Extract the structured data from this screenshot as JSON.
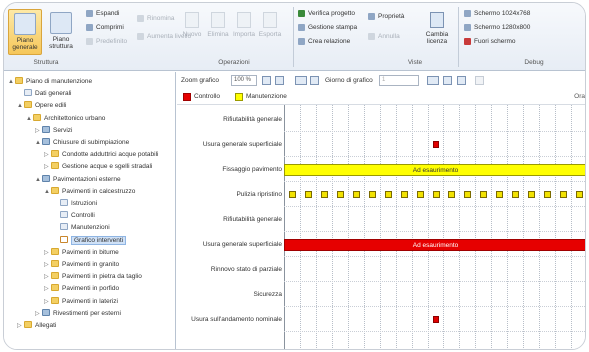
{
  "ribbon": {
    "large_buttons": [
      {
        "label": "Piano generale",
        "icon": "plan-icon",
        "active": true
      },
      {
        "label": "Piano struttura",
        "icon": "structure-icon",
        "active": false
      }
    ],
    "col1": [
      "Espandi",
      "Comprimi",
      "Predefinito"
    ],
    "col2": [
      "Rinomina",
      "Aumenta livello"
    ],
    "mid_buttons": [
      "Nuovo",
      "Elimina",
      "Importa",
      "Esporta"
    ],
    "col4": [
      "Verifica progetto",
      "Gestione stampa",
      "Crea relazione"
    ],
    "col5": [
      "Proprietà",
      "Annulla"
    ],
    "cambia": "Cambia licenza",
    "right_col": [
      "Schermo 1024x768",
      "Schermo 1280x800",
      "Fuori schermo"
    ],
    "groups": [
      "Struttura",
      "Operazioni",
      "Viste",
      "Debug"
    ]
  },
  "tree": {
    "items": [
      {
        "label": "Piano di manutenzione",
        "depth": 0,
        "toggle": "▲",
        "icon": "folder"
      },
      {
        "label": "Dati generali",
        "depth": 1,
        "toggle": "",
        "icon": "doc"
      },
      {
        "label": "Opere edili",
        "depth": 1,
        "toggle": "▲",
        "icon": "folder"
      },
      {
        "label": "Architettonico urbano",
        "depth": 2,
        "toggle": "▲",
        "icon": "folder"
      },
      {
        "label": "Servizi",
        "depth": 3,
        "toggle": "▷",
        "icon": "net"
      },
      {
        "label": "Chiusure di subimpiazione",
        "depth": 3,
        "toggle": "▲",
        "icon": "net"
      },
      {
        "label": "Condotte adduttrici acque potabili",
        "depth": 4,
        "toggle": "▷",
        "icon": "folder"
      },
      {
        "label": "Gestione acque e sgelli stradali",
        "depth": 4,
        "toggle": "▷",
        "icon": "folder"
      },
      {
        "label": "Pavimentazioni esterne",
        "depth": 3,
        "toggle": "▲",
        "icon": "net"
      },
      {
        "label": "Pavimenti in calcestruzzo",
        "depth": 4,
        "toggle": "▲",
        "icon": "folder"
      },
      {
        "label": "Istruzioni",
        "depth": 5,
        "toggle": "",
        "icon": "doc"
      },
      {
        "label": "Controlli",
        "depth": 5,
        "toggle": "",
        "icon": "doc"
      },
      {
        "label": "Manutenzioni",
        "depth": 5,
        "toggle": "",
        "icon": "doc"
      },
      {
        "label": "Grafico interventi",
        "depth": 5,
        "toggle": "",
        "icon": "chart",
        "selected": true
      },
      {
        "label": "Pavimenti in bitume",
        "depth": 4,
        "toggle": "▷",
        "icon": "folder"
      },
      {
        "label": "Pavimenti in granito",
        "depth": 4,
        "toggle": "▷",
        "icon": "folder"
      },
      {
        "label": "Pavimenti in pietra da taglio",
        "depth": 4,
        "toggle": "▷",
        "icon": "folder"
      },
      {
        "label": "Pavimenti in porfido",
        "depth": 4,
        "toggle": "▷",
        "icon": "folder"
      },
      {
        "label": "Pavimenti in laterizi",
        "depth": 4,
        "toggle": "▷",
        "icon": "folder"
      },
      {
        "label": "Rivestimenti per esterni",
        "depth": 3,
        "toggle": "▷",
        "icon": "net"
      },
      {
        "label": "Allegati",
        "depth": 1,
        "toggle": "▷",
        "icon": "folder"
      }
    ]
  },
  "toolbar": {
    "zoom_label": "Zoom grafico",
    "zoom_value": "100 %",
    "start_label": "Giorno di grafico",
    "start_value": "1"
  },
  "legend": {
    "items": [
      {
        "label": "Controllo",
        "color": "#e60000"
      },
      {
        "label": "Manutenzione",
        "color": "#ffff00"
      }
    ],
    "right_text": "Ora"
  },
  "gantt": {
    "rows": [
      {
        "label": "Rifiutabilità generale"
      },
      {
        "label": "Usura generale superficiale"
      },
      {
        "label": "Fissaggio pavimento",
        "bar_text": "Ad esaurimento"
      },
      {
        "label": "Pulizia ripristino"
      },
      {
        "label": "Rifiutabilità generale"
      },
      {
        "label": "Usura generale superficiale",
        "bar_text": "Ad esaurimento"
      },
      {
        "label": "Rinnovo stato di parziale"
      },
      {
        "label": "Sicurezza"
      },
      {
        "label": "Usura sull'andamento nominale"
      }
    ]
  }
}
